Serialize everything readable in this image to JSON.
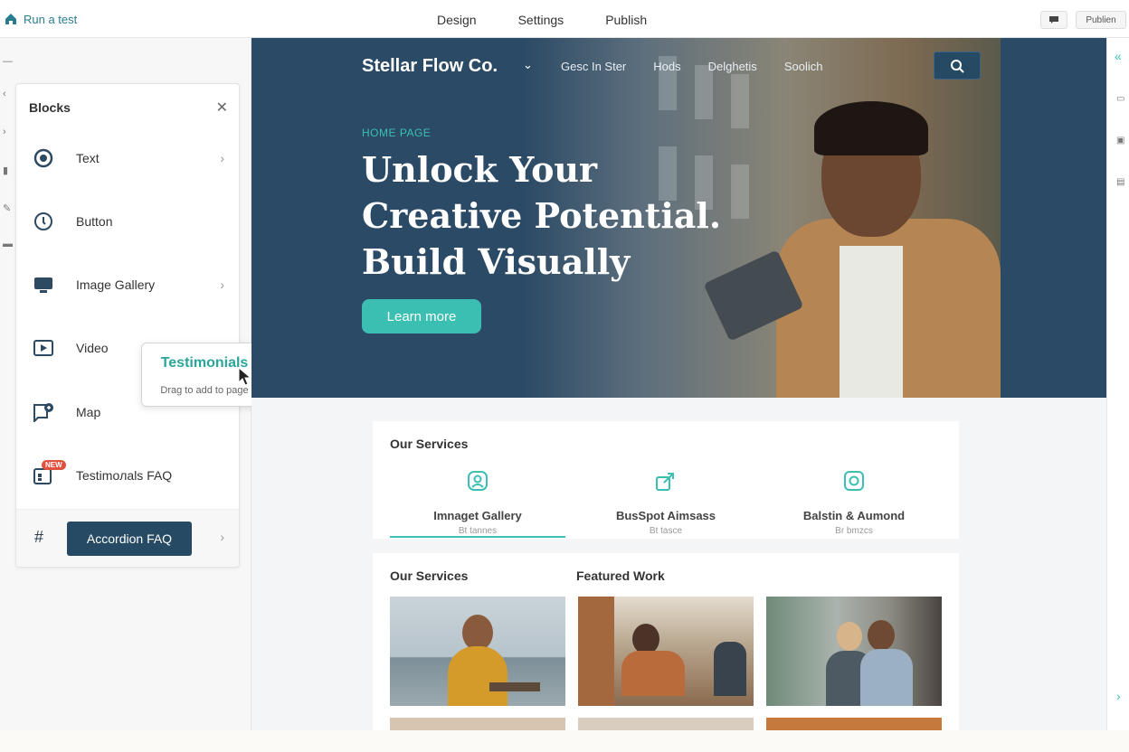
{
  "topbar": {
    "run_test_label": "Run a test",
    "nav": [
      "Design",
      "Settings",
      "Publish"
    ],
    "publish_label": "Publien"
  },
  "blocks_panel": {
    "title": "Blocks",
    "items": [
      {
        "label": "Text",
        "icon": "text-block-icon",
        "has_chevron": true
      },
      {
        "label": "Button",
        "icon": "button-block-icon",
        "has_chevron": false
      },
      {
        "label": "Image Gallery",
        "icon": "image-gallery-icon",
        "has_chevron": true
      },
      {
        "label": "Video",
        "icon": "video-icon",
        "has_chevron": false
      },
      {
        "label": "Map",
        "icon": "map-icon",
        "has_chevron": false
      },
      {
        "label": "Testimoлals FAQ",
        "icon": "testimonials-icon",
        "badge": "NEW",
        "has_chevron": false
      }
    ],
    "footer_button": "Accordion FAQ"
  },
  "drag_tooltip": {
    "title": "Testimonials",
    "subtitle": "Drag to add to page"
  },
  "hero": {
    "brand": "Stellar Flow Co.",
    "nav": [
      "Gesc In Ster",
      "Hods",
      "Delghetis",
      "Soolich"
    ],
    "eyebrow": "HOME PAGE",
    "title_lines": [
      "Unlock Your",
      "Creative Potential.",
      "Build Visually"
    ],
    "cta": "Learn more"
  },
  "services": {
    "title": "Our Services",
    "items": [
      {
        "label": "Imnaget Gallery",
        "sub": "Bt tannes",
        "icon": "user-circle-icon"
      },
      {
        "label": "BusSpot Aimsass",
        "sub": "Bt tasce",
        "icon": "share-box-icon"
      },
      {
        "label": "Balstin & Aumond",
        "sub": "Br bmzcs",
        "icon": "camera-icon"
      }
    ]
  },
  "work": {
    "left_title": "Our Services",
    "right_title": "Featured Work"
  },
  "colors": {
    "accent": "#3bbfb2",
    "navy": "#264a63",
    "hero_bg": "#2b4a65"
  }
}
